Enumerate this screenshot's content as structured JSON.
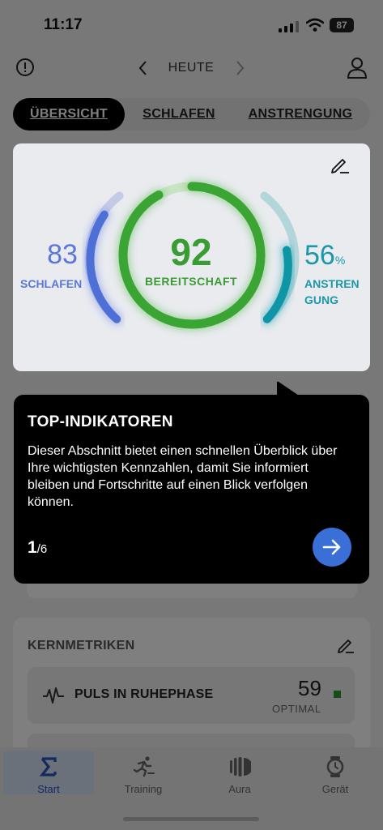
{
  "status_bar": {
    "time": "11:17",
    "battery": "87"
  },
  "header": {
    "date_label": "HEUTE"
  },
  "tabs": [
    {
      "label": "ÜBERSICHT",
      "active": true
    },
    {
      "label": "SCHLAFEN",
      "active": false
    },
    {
      "label": "ANSTRENGUNG",
      "active": false
    }
  ],
  "readiness_card": {
    "sleep": {
      "value": "83",
      "label": "SCHLAFEN",
      "color": "#5b78d6"
    },
    "readiness": {
      "value": "92",
      "label": "BEREITSCHAFT",
      "color": "#3a9c32"
    },
    "strain": {
      "value": "56",
      "unit": "%",
      "label": "ANSTRENGUNG",
      "color": "#1a98a8"
    }
  },
  "core_metrics": {
    "title": "KERNMETRIKEN",
    "items": [
      {
        "name": "PULS IN RUHEPHASE",
        "value": "59",
        "status": "OPTIMAL"
      }
    ]
  },
  "tooltip": {
    "title": "TOP-INDIKATOREN",
    "body": "Dieser Abschnitt bietet einen schnellen Überblick über Ihre wichtigsten Kennzahlen, damit Sie informiert bleiben und Fortschritte auf einen Blick verfolgen können.",
    "current": "1",
    "total": "/6"
  },
  "bottom_nav": [
    {
      "label": "Start",
      "icon": "sigma-icon",
      "active": true
    },
    {
      "label": "Training",
      "icon": "running-icon",
      "active": false
    },
    {
      "label": "Aura",
      "icon": "aura-icon",
      "active": false
    },
    {
      "label": "Gerät",
      "icon": "watch-icon",
      "active": false
    }
  ],
  "colors": {
    "accent": "#3b6fd8",
    "optimal": "#2d9a2d"
  }
}
